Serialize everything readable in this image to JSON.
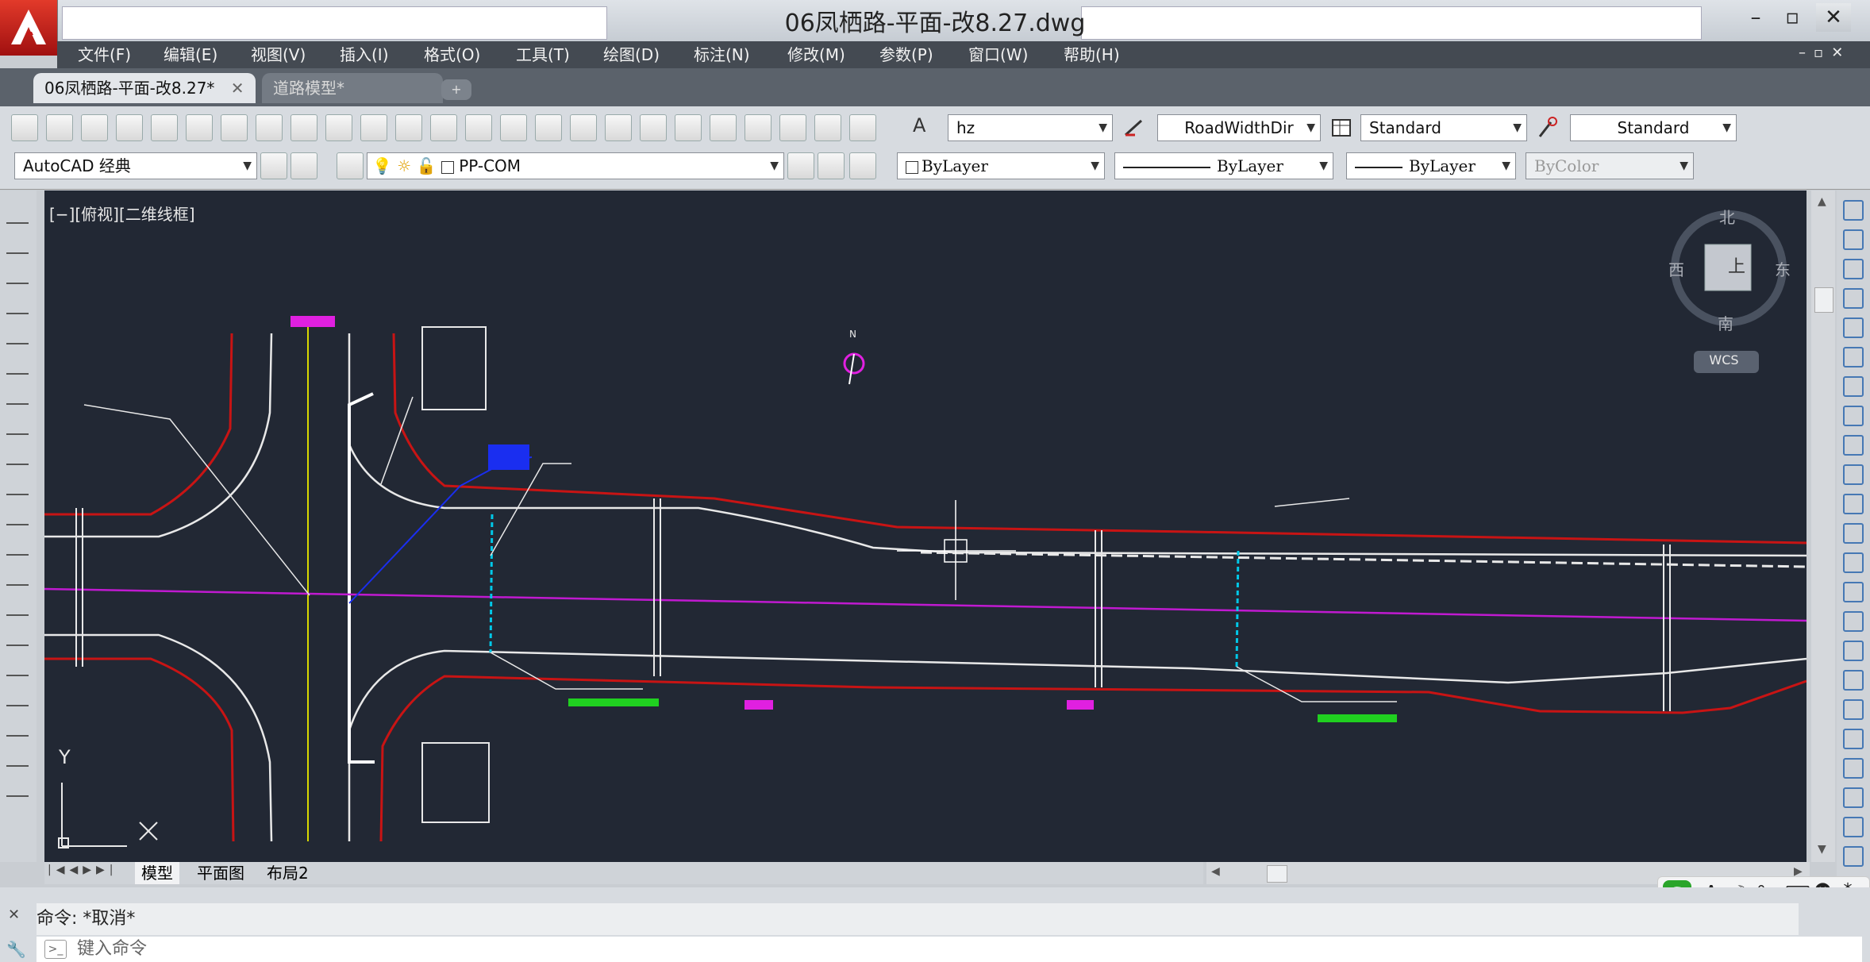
{
  "window": {
    "title": "06凤栖路-平面-改8.27.dwg"
  },
  "menu": [
    "文件(F)",
    "编辑(E)",
    "视图(V)",
    "插入(I)",
    "格式(O)",
    "工具(T)",
    "绘图(D)",
    "标注(N)",
    "修改(M)",
    "参数(P)",
    "窗口(W)",
    "帮助(H)"
  ],
  "tabs": [
    {
      "label": "06凤栖路-平面-改8.27*",
      "active": true
    },
    {
      "label": "道路模型*",
      "active": false
    }
  ],
  "toolbar": {
    "text_style": "hz",
    "dim_style": "RoadWidthDir",
    "table_style": "Standard",
    "mleader_style": "Standard",
    "workspace": "AutoCAD 经典",
    "layer": "PP-COM",
    "color": "ByLayer",
    "linetype": "ByLayer",
    "lineweight": "ByLayer",
    "plotstyle": "ByColor"
  },
  "viewport": {
    "label": "[−][俯视][二维线框]",
    "compass": {
      "north": "北",
      "south": "南",
      "east": "东",
      "west": "西",
      "cube_face": "上",
      "wcs": "WCS"
    },
    "ucs": {
      "y": "Y",
      "x": "X"
    },
    "north_arrow": "N"
  },
  "layout_tabs": [
    "模型",
    "平面图",
    "布局2"
  ],
  "command": {
    "history": "命令:  *取消*",
    "placeholder": "键入命令"
  },
  "colors": {
    "road_edge": "#c81414",
    "centerline": "#c01ad0",
    "lane": "#e8e8e8",
    "marker": "#00c8e8",
    "label_green": "#20d020",
    "label_blue": "#1a2ef0"
  }
}
